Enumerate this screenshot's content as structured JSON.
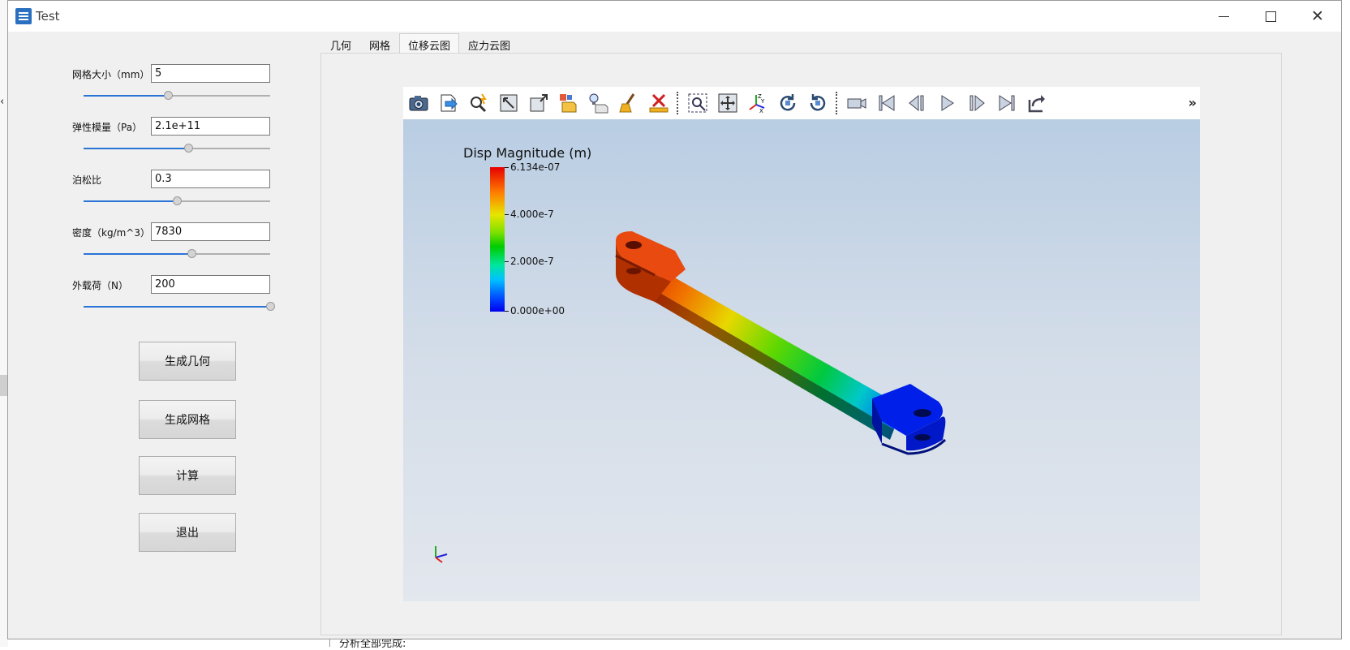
{
  "background": {
    "bottom_text": "分析全部完成:"
  },
  "window": {
    "title": "Test"
  },
  "params": [
    {
      "label": "网格大小（mm）",
      "value": "5",
      "slider": 0.45
    },
    {
      "label": "弹性模量（Pa）",
      "value": "2.1e+11",
      "slider": 0.56
    },
    {
      "label": "泊松比",
      "value": "0.3",
      "slider": 0.5
    },
    {
      "label": "密度（kg/m^3）",
      "value": "7830",
      "slider": 0.58
    },
    {
      "label": "外载荷（N）",
      "value": "200",
      "slider": 1.0
    }
  ],
  "buttons": {
    "gen_geometry": "生成几何",
    "gen_mesh": "生成网格",
    "compute": "计算",
    "exit": "退出"
  },
  "tabs": [
    "几何",
    "网格",
    "位移云图",
    "应力云图"
  ],
  "active_tab": 2,
  "viewer": {
    "legend_title": "Disp Magnitude (m)",
    "legend_labels": [
      "6.134e-07",
      "4.000e-7",
      "2.000e-7",
      "0.000e+00"
    ],
    "more_label": "»",
    "axis_letters": [
      "Z",
      "Y",
      "X"
    ]
  },
  "colors": {
    "slider_accent": "#2a74d6",
    "max_color": "#e60000",
    "min_color": "#0000ee"
  }
}
